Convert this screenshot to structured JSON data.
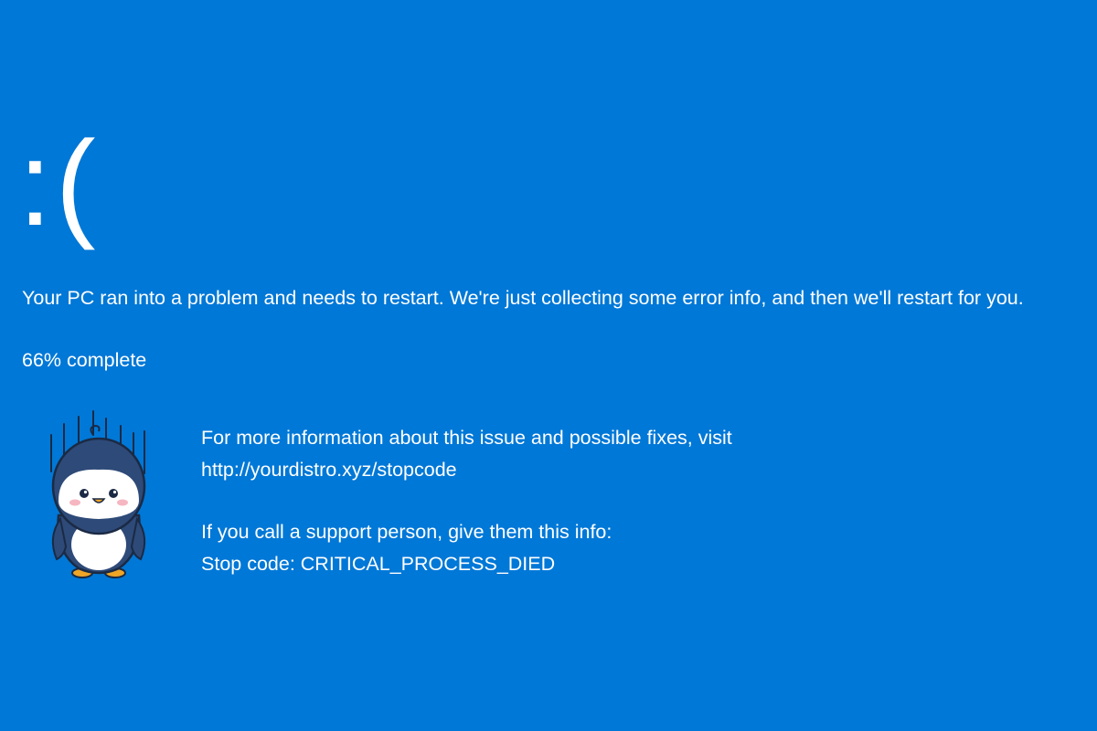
{
  "screen": {
    "background_color": "#0078d7",
    "text_color": "#ffffff",
    "sad_face": ":(",
    "message": "Your PC ran into a problem and needs to restart. We're just collecting some error info, and then we'll restart for you.",
    "progress": {
      "text": "66% complete",
      "percent": 66
    },
    "mascot": {
      "icon": "sad-penguin-icon"
    },
    "info": {
      "more_info": "For more information about this issue and possible fixes, visit",
      "url": "http://yourdistro.xyz/stopcode",
      "support": "If you call a support person, give them this info:",
      "stop_code": "Stop code: CRITICAL_PROCESS_DIED"
    }
  }
}
